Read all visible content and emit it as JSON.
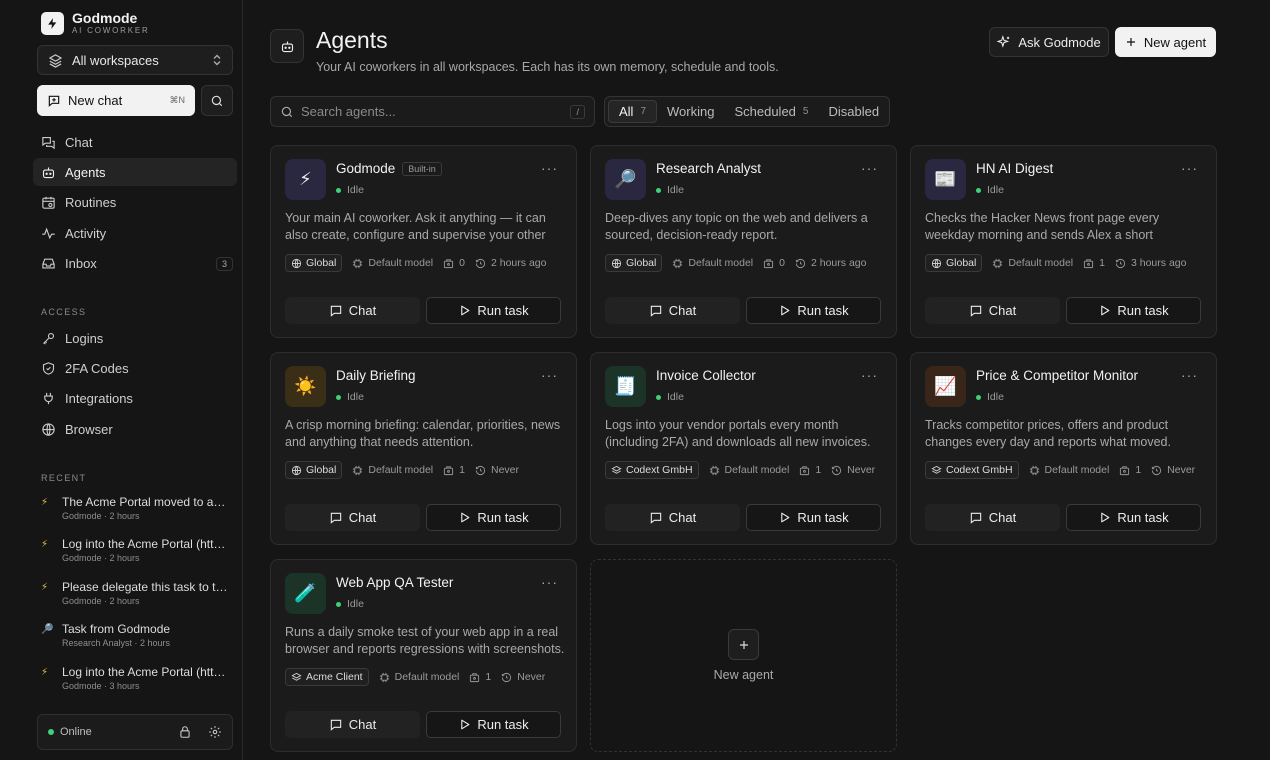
{
  "brand": {
    "name": "Godmode",
    "subtitle": "AI COWORKER"
  },
  "workspace": {
    "label": "All workspaces"
  },
  "new_chat": {
    "label": "New chat",
    "shortcut": "⌘N"
  },
  "nav": [
    {
      "label": "Chat",
      "icon": "chat-icon"
    },
    {
      "label": "Agents",
      "icon": "robot-icon",
      "active": true
    },
    {
      "label": "Routines",
      "icon": "calendar-icon"
    },
    {
      "label": "Activity",
      "icon": "activity-icon"
    },
    {
      "label": "Inbox",
      "icon": "inbox-icon",
      "count": "3"
    }
  ],
  "access": {
    "title": "ACCESS",
    "items": [
      {
        "label": "Logins",
        "icon": "key-icon"
      },
      {
        "label": "2FA Codes",
        "icon": "shield-icon"
      },
      {
        "label": "Integrations",
        "icon": "plug-icon"
      },
      {
        "label": "Browser",
        "icon": "globe-icon"
      }
    ]
  },
  "recent": {
    "title": "RECENT",
    "items": [
      {
        "title": "The Acme Portal moved to a new...",
        "meta": "Godmode · 2 hours",
        "icon": "bolt-icon"
      },
      {
        "title": "Log into the Acme Portal (http://...",
        "meta": "Godmode · 2 hours",
        "icon": "bolt-icon"
      },
      {
        "title": "Please delegate this task to the...",
        "meta": "Godmode · 2 hours",
        "icon": "bolt-icon"
      },
      {
        "title": "Task from Godmode",
        "meta": "Research Analyst · 2 hours",
        "icon": "magnifier-icon"
      },
      {
        "title": "Log into the Acme Portal (http://...",
        "meta": "Godmode · 3 hours",
        "icon": "bolt-icon"
      }
    ]
  },
  "status": {
    "label": "Online"
  },
  "header": {
    "title": "Agents",
    "subtitle": "Your AI coworkers in all workspaces. Each has its own memory, schedule and tools.",
    "ask_label": "Ask Godmode",
    "new_label": "New agent"
  },
  "search": {
    "placeholder": "Search agents...",
    "shortcut": "/"
  },
  "filters": [
    {
      "label": "All",
      "count": "7",
      "active": true
    },
    {
      "label": "Working",
      "count": ""
    },
    {
      "label": "Scheduled",
      "count": "5"
    },
    {
      "label": "Disabled",
      "count": ""
    }
  ],
  "agents": [
    {
      "name": "Godmode",
      "badge": "Built-in",
      "state": "Idle",
      "emoji": "⚡",
      "av_bg": "#2a2840",
      "desc": "Your main AI coworker. Ask it anything — it can also create, configure and supervise your other agents.",
      "scope": "Global",
      "model": "Default model",
      "tools": "0",
      "last": "2 hours ago"
    },
    {
      "name": "Research Analyst",
      "badge": "",
      "state": "Idle",
      "emoji": "🔎",
      "av_bg": "#2a2840",
      "desc": "Deep-dives any topic on the web and delivers a sourced, decision-ready report.",
      "scope": "Global",
      "model": "Default model",
      "tools": "0",
      "last": "2 hours ago"
    },
    {
      "name": "HN AI Digest",
      "badge": "",
      "state": "Idle",
      "emoji": "📰",
      "av_bg": "#2a2840",
      "desc": "Checks the Hacker News front page every weekday morning and sends Alex a short summary.",
      "scope": "Global",
      "model": "Default model",
      "tools": "1",
      "last": "3 hours ago"
    },
    {
      "name": "Daily Briefing",
      "badge": "",
      "state": "Idle",
      "emoji": "☀️",
      "av_bg": "#3a2f16",
      "desc": "A crisp morning briefing: calendar, priorities, news and anything that needs attention.",
      "scope": "Global",
      "model": "Default model",
      "tools": "1",
      "last": "Never"
    },
    {
      "name": "Invoice Collector",
      "badge": "",
      "state": "Idle",
      "emoji": "🧾",
      "av_bg": "#1c3328",
      "desc": "Logs into your vendor portals every month (including 2FA) and downloads all new invoices.",
      "scope": "Codext GmbH",
      "model": "Default model",
      "tools": "1",
      "last": "Never"
    },
    {
      "name": "Price & Competitor Monitor",
      "badge": "",
      "state": "Idle",
      "emoji": "📈",
      "av_bg": "#3a2618",
      "desc": "Tracks competitor prices, offers and product changes every day and reports what moved.",
      "scope": "Codext GmbH",
      "model": "Default model",
      "tools": "1",
      "last": "Never"
    },
    {
      "name": "Web App QA Tester",
      "badge": "",
      "state": "Idle",
      "emoji": "🧪",
      "av_bg": "#1c3328",
      "desc": "Runs a daily smoke test of your web app in a real browser and reports regressions with screenshots.",
      "scope": "Acme Client",
      "model": "Default model",
      "tools": "1",
      "last": "Never"
    }
  ],
  "card_labels": {
    "chat": "Chat",
    "run": "Run task"
  },
  "new_agent_card": {
    "label": "New agent"
  }
}
